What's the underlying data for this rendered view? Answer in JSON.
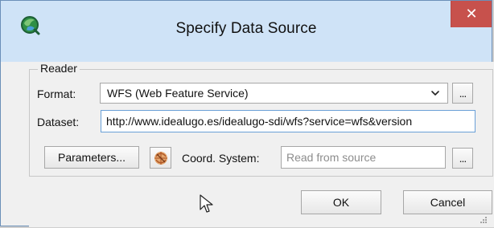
{
  "window": {
    "title": "Specify Data Source",
    "close_label": "✕",
    "colors": {
      "titlebar": "#cfe3f7",
      "close_button": "#c7514c",
      "window_border": "#6b8fb8",
      "dialog_background": "#f0f0f0"
    },
    "icons": {
      "app": "qgis-icon",
      "close": "close-icon",
      "coord_system": "coordinate-system-icon",
      "dropdown": "chevron-down-icon",
      "resize": "resize-grip-icon",
      "cursor": "mouse-cursor-icon"
    }
  },
  "reader": {
    "group_title": "Reader",
    "format_label": "Format:",
    "format_value": "WFS (Web Feature Service)",
    "format_browse_label": "...",
    "dataset_label": "Dataset:",
    "dataset_value": "http://www.idealugo.es/idealugo-sdi/wfs?service=wfs&version",
    "parameters_button": "Parameters...",
    "coord_system_label": "Coord. System:",
    "coord_system_placeholder": "Read from source",
    "coord_system_browse_label": "..."
  },
  "footer": {
    "ok_button": "OK",
    "cancel_button": "Cancel"
  }
}
